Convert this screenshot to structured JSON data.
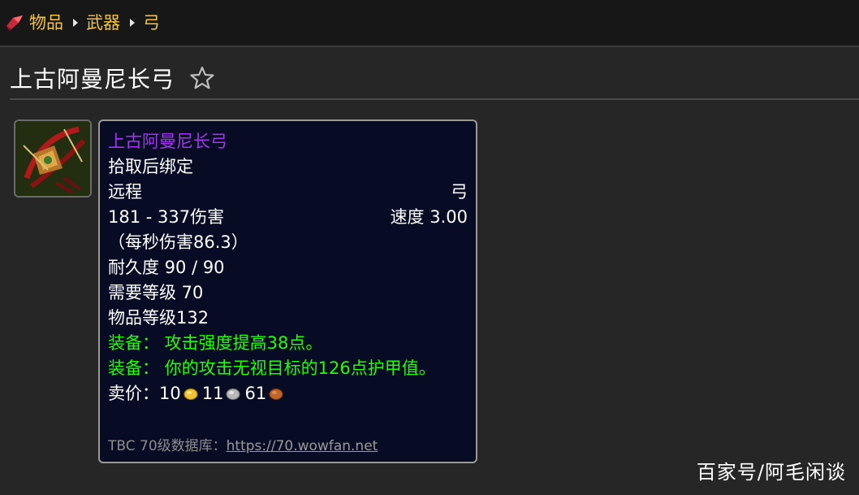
{
  "breadcrumb": {
    "items": [
      "物品",
      "武器",
      "弓"
    ]
  },
  "page_title": "上古阿曼尼长弓",
  "icons": {
    "logo": "wowfan-logo-icon",
    "favorite": "star-outline-icon",
    "item": "bow-item-icon",
    "gold": "gold-coin-icon",
    "silver": "silver-coin-icon",
    "copper": "copper-coin-icon"
  },
  "colors": {
    "breadcrumb": "#f4c53c",
    "epic_quality": "#a335ee",
    "equip_effect": "#1eff00",
    "tooltip_bg": "#070b24"
  },
  "tooltip": {
    "name": "上古阿曼尼长弓",
    "binding": "拾取后绑定",
    "slot": "远程",
    "type": "弓",
    "damage": "181 - 337伤害",
    "speed": "速度 3.00",
    "dps": "（每秒伤害86.3）",
    "durability": "耐久度 90 / 90",
    "required_level": "需要等级 70",
    "item_level": "物品等级132",
    "equip_1": "装备： 攻击强度提高38点。",
    "equip_2": "装备： 你的攻击无视目标的126点护甲值。",
    "sell_label": "卖价：",
    "sell_gold": "10",
    "sell_silver": "11",
    "sell_copper": "61",
    "footer_label": "TBC 70级数据库：",
    "footer_link": "https://70.wowfan.net"
  },
  "watermark": "百家号/阿毛闲谈"
}
